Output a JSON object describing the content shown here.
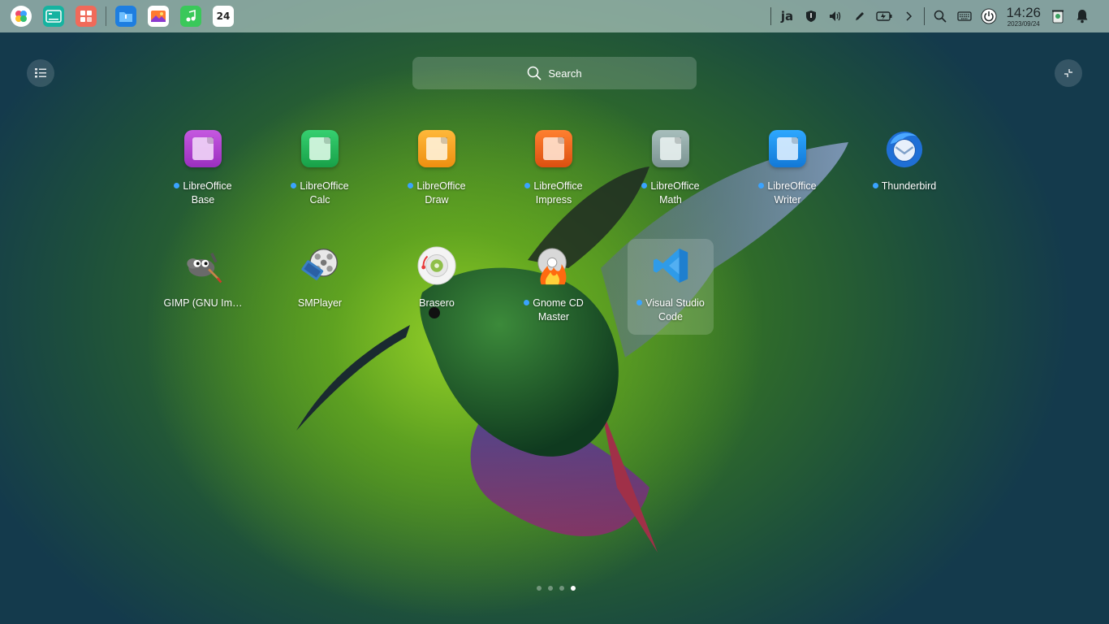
{
  "dock": {
    "items": [
      {
        "name": "launcher-icon",
        "label": ""
      },
      {
        "name": "terminal-icon",
        "label": ""
      },
      {
        "name": "app-store-icon",
        "label": ""
      },
      {
        "name": "file-manager-icon",
        "label": ""
      },
      {
        "name": "image-viewer-icon",
        "label": ""
      },
      {
        "name": "music-icon",
        "label": ""
      },
      {
        "name": "calendar-icon",
        "label": "24"
      }
    ]
  },
  "tray": {
    "input_method": "ja",
    "time": "14:26",
    "date": "2023/09/24"
  },
  "search": {
    "placeholder": "Search"
  },
  "apps": [
    {
      "label": "LibreOffice Base",
      "line1": "LibreOffice",
      "line2": "Base",
      "new": true,
      "icon": "libreoffice-base-icon",
      "color": "#b444d0"
    },
    {
      "label": "LibreOffice Calc",
      "line1": "LibreOffice",
      "line2": "Calc",
      "new": true,
      "icon": "libreoffice-calc-icon",
      "color": "#22b85a"
    },
    {
      "label": "LibreOffice Draw",
      "line1": "LibreOffice",
      "line2": "Draw",
      "new": true,
      "icon": "libreoffice-draw-icon",
      "color": "#f4a21c"
    },
    {
      "label": "LibreOffice Impress",
      "line1": "LibreOffice",
      "line2": "Impress",
      "new": true,
      "icon": "libreoffice-impress-icon",
      "color": "#e9641c"
    },
    {
      "label": "LibreOffice Math",
      "line1": "LibreOffice",
      "line2": "Math",
      "new": true,
      "icon": "libreoffice-math-icon",
      "color": "#8fa6a4"
    },
    {
      "label": "LibreOffice Writer",
      "line1": "LibreOffice",
      "line2": "Writer",
      "new": true,
      "icon": "libreoffice-writer-icon",
      "color": "#1a8ee6"
    },
    {
      "label": "Thunderbird",
      "line1": "Thunderbird",
      "line2": "",
      "new": true,
      "icon": "thunderbird-icon",
      "color": "#1f6fd6"
    },
    {
      "label": "GIMP (GNU Im…",
      "line1": "GIMP (GNU Im…",
      "line2": "",
      "new": false,
      "icon": "gimp-icon",
      "color": "#6b6b6b"
    },
    {
      "label": "SMPlayer",
      "line1": "SMPlayer",
      "line2": "",
      "new": false,
      "icon": "smplayer-icon",
      "color": "#3a7fc4"
    },
    {
      "label": "Brasero",
      "line1": "Brasero",
      "line2": "",
      "new": false,
      "icon": "brasero-icon",
      "color": "#e8e8e8"
    },
    {
      "label": "Gnome CD Master",
      "line1": "Gnome CD",
      "line2": "Master",
      "new": true,
      "icon": "gnome-cd-master-icon",
      "color": "#e04020"
    },
    {
      "label": "Visual Studio Code",
      "line1": "Visual Studio",
      "line2": "Code",
      "new": true,
      "icon": "vscode-icon",
      "color": "#2f9be8"
    }
  ],
  "pager": {
    "pages": 4,
    "active": 4
  }
}
